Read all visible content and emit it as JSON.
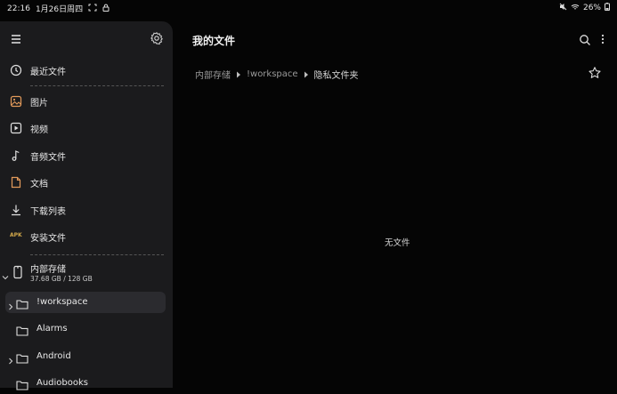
{
  "status_bar": {
    "time": "22:16",
    "date": "1月26日周四",
    "battery": "26%",
    "icons": [
      "screenshot-icon",
      "lock-icon",
      "mute-icon",
      "wifi-icon",
      "battery-icon"
    ]
  },
  "sidebar": {
    "icons": {
      "menu": "menu-icon",
      "settings": "gear-icon"
    },
    "nav_items": [
      {
        "label": "最近文件",
        "icon": "clock-icon"
      },
      {
        "label": "图片",
        "icon": "image-icon"
      },
      {
        "label": "视频",
        "icon": "video-icon"
      },
      {
        "label": "音频文件",
        "icon": "music-note-icon"
      },
      {
        "label": "文档",
        "icon": "document-icon"
      },
      {
        "label": "下载列表",
        "icon": "download-icon"
      },
      {
        "label": "安装文件",
        "icon": "apk-icon",
        "icon_text": "APK"
      }
    ],
    "storage": {
      "label": "内部存储",
      "usage": "37.68 GB / 128 GB",
      "icon": "phone-icon"
    },
    "folders": [
      {
        "label": "!workspace",
        "expandable": true,
        "selected": true
      },
      {
        "label": "Alarms",
        "expandable": false,
        "selected": false
      },
      {
        "label": "Android",
        "expandable": true,
        "selected": false
      },
      {
        "label": "Audiobooks",
        "expandable": false,
        "selected": false
      }
    ]
  },
  "main": {
    "title": "我的文件",
    "breadcrumb": [
      "内部存储",
      "!workspace",
      "隐私文件夹"
    ],
    "empty_message": "无文件"
  },
  "colors": {
    "background": "#050505",
    "sidebar": "#1b1b1d",
    "selected_row": "#2b2b2f",
    "icon_orange": "#e39a5b",
    "apk_label": "#d3a94b"
  }
}
